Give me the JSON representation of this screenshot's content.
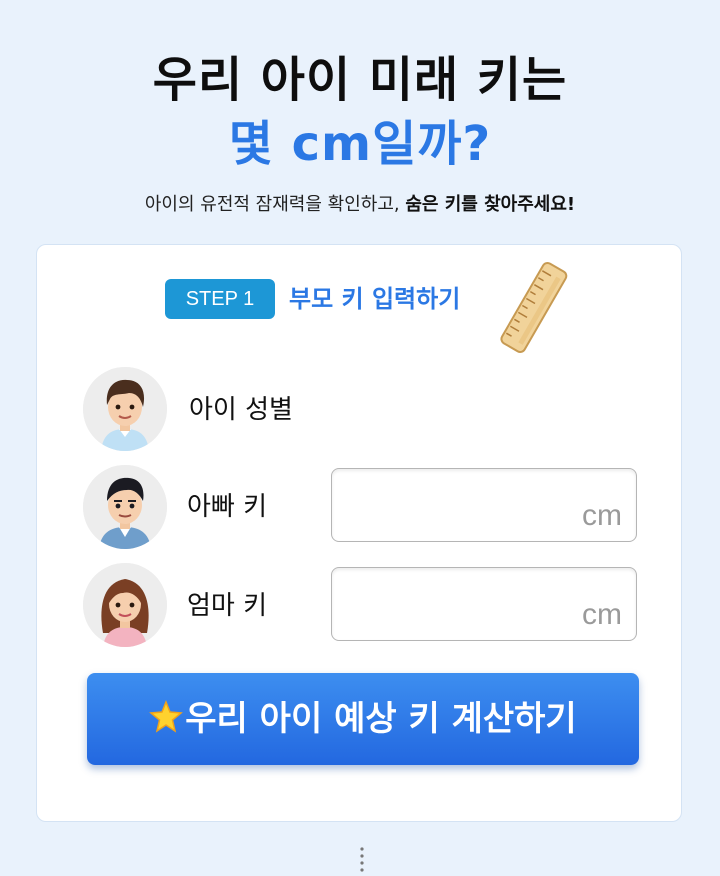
{
  "hero": {
    "title_line1": "우리 아이 미래 키는",
    "title_line2": "몇 cm일까?",
    "subtitle_normal": "아이의 유전적 잠재력을 확인하고, ",
    "subtitle_bold": "숨은 키를 찾아주세요!"
  },
  "step": {
    "badge": "STEP 1",
    "title": "부모 키 입력하기",
    "icon": "ruler-icon"
  },
  "rows": {
    "child": {
      "label": "아이 성별",
      "icon": "boy-avatar-icon"
    },
    "father": {
      "label": "아빠 키",
      "unit": "cm",
      "value": "",
      "icon": "father-avatar-icon"
    },
    "mother": {
      "label": "엄마 키",
      "unit": "cm",
      "value": "",
      "icon": "mother-avatar-icon"
    }
  },
  "button": {
    "label": "우리 아이 예상 키 계산하기",
    "icon": "star-icon"
  },
  "colors": {
    "accent": "#2b78e4",
    "badge": "#1d97d6",
    "background": "#e9f2fc"
  }
}
